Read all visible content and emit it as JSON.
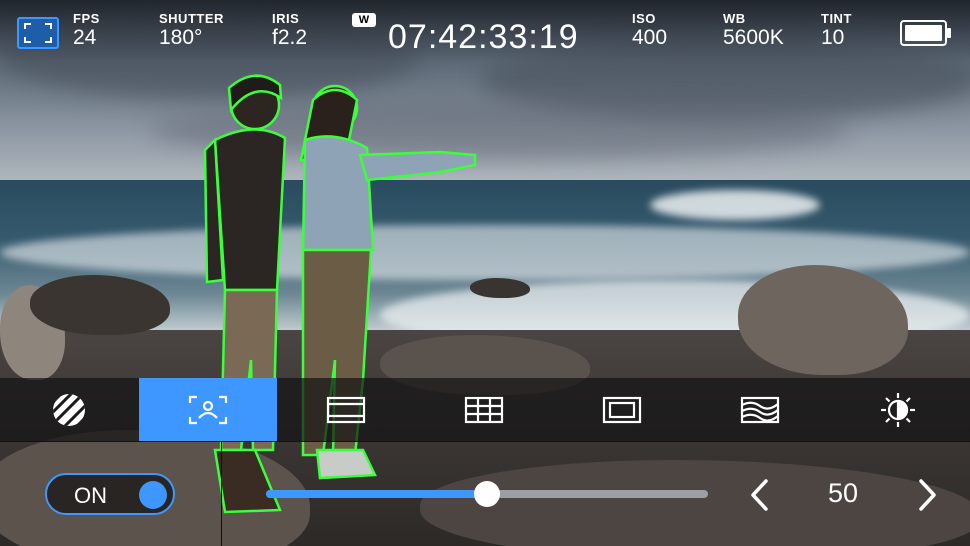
{
  "status": {
    "fps": {
      "label": "FPS",
      "value": "24"
    },
    "shutter": {
      "label": "SHUTTER",
      "value": "180°"
    },
    "iris": {
      "label": "IRIS",
      "value": "f2.2"
    },
    "wb_badge": "W",
    "timecode": "07:42:33:19",
    "iso": {
      "label": "ISO",
      "value": "400"
    },
    "wb": {
      "label": "WB",
      "value": "5600K"
    },
    "tint": {
      "label": "TINT",
      "value": "10"
    }
  },
  "toolbar": {
    "tools": [
      {
        "icon": "zebra-icon",
        "active": false
      },
      {
        "icon": "focus-assist-icon",
        "active": true
      },
      {
        "icon": "frame-guides-icon",
        "active": false
      },
      {
        "icon": "grid-icon",
        "active": false
      },
      {
        "icon": "safe-area-icon",
        "active": false
      },
      {
        "icon": "false-color-icon",
        "active": false
      },
      {
        "icon": "brightness-icon",
        "active": false
      }
    ]
  },
  "control": {
    "toggle_label": "ON",
    "toggle_on": true,
    "level": 50,
    "level_display": "50"
  },
  "colors": {
    "accent": "#3e97ff",
    "focus_peaking": "#3cff3c"
  }
}
